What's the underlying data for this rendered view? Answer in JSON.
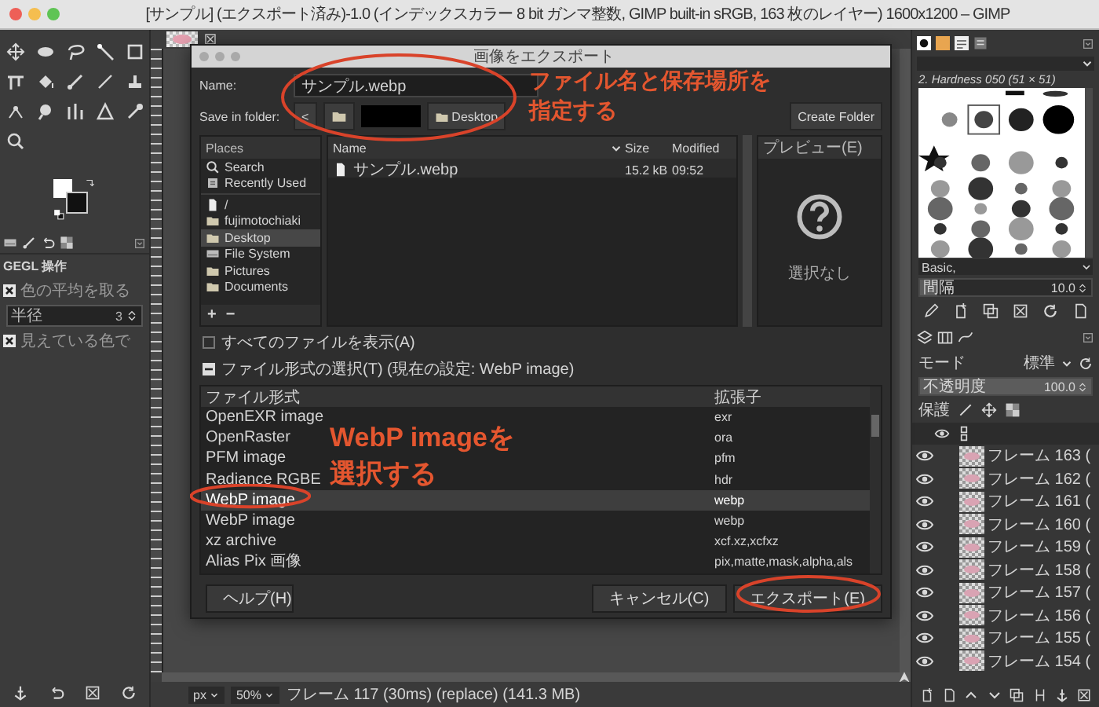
{
  "window": {
    "title": "[サンプル] (エクスポート済み)-1.0 (インデックスカラー 8 bit ガンマ整数, GIMP built-in sRGB, 163 枚のレイヤー) 1600x1200 – GIMP"
  },
  "tool_options": {
    "title": "GEGL 操作",
    "items": [
      {
        "kind": "checkbox",
        "label": "色の平均を取る",
        "checked": true
      },
      {
        "kind": "dropdown",
        "label": "半径",
        "value": "3"
      },
      {
        "kind": "checkbox",
        "label": "見えている色で",
        "checked": true
      }
    ]
  },
  "status_bar": {
    "unit": "px",
    "zoom": "50%",
    "message": "フレーム 117 (30ms) (replace) (141.3 MB)"
  },
  "right_dock": {
    "brush_name": "2. Hardness 050 (51 × 51)",
    "brush_tag": "Basic,",
    "spacing": {
      "label": "間隔",
      "value": "10.0",
      "level": 0.1
    },
    "mode": {
      "label": "モード",
      "value": "標準"
    },
    "opacity": {
      "label": "不透明度",
      "value": "100.0",
      "level": 1
    },
    "lock_label": "保護",
    "layers": [
      {
        "name": "フレーム 163 (",
        "visible": true
      },
      {
        "name": "フレーム 162 (",
        "visible": true
      },
      {
        "name": "フレーム 161 (",
        "visible": true
      },
      {
        "name": "フレーム 160 (",
        "visible": true
      },
      {
        "name": "フレーム 159 (",
        "visible": true
      },
      {
        "name": "フレーム 158 (",
        "visible": true
      },
      {
        "name": "フレーム 157 (",
        "visible": true
      },
      {
        "name": "フレーム 156 (",
        "visible": true
      },
      {
        "name": "フレーム 155 (",
        "visible": true
      },
      {
        "name": "フレーム 154 (",
        "visible": true
      }
    ]
  },
  "dialog": {
    "title": "画像をエクスポート",
    "name_label": "Name:",
    "file_name": "サンプル.webp",
    "folder_label": "Save in folder:",
    "back": "<",
    "folder_button": "Desktop",
    "create_folder": "Create Folder",
    "places": {
      "header": "Places",
      "groups": [
        [
          {
            "kind": "search",
            "label": "Search",
            "selected": false
          },
          {
            "kind": "recent",
            "label": "Recently Used",
            "selected": false
          }
        ],
        [
          {
            "kind": "file",
            "label": "/",
            "selected": false
          },
          {
            "kind": "folder",
            "label": "fujimotochiaki",
            "selected": false
          },
          {
            "kind": "folder",
            "label": "Desktop",
            "selected": true
          },
          {
            "kind": "drive",
            "label": "File System",
            "selected": false
          },
          {
            "kind": "folder",
            "label": "Pictures",
            "selected": false
          },
          {
            "kind": "folder",
            "label": "Documents",
            "selected": false
          }
        ]
      ],
      "add": "+",
      "remove": "−"
    },
    "files": {
      "columns": [
        "Name",
        "Size",
        "Modified"
      ],
      "rows": [
        {
          "name": "サンプル.webp",
          "size": "15.2 kB",
          "modified": "09:52"
        }
      ]
    },
    "preview": {
      "label": "プレビュー(E)",
      "empty_text": "選択なし"
    },
    "show_all": {
      "label": "すべてのファイルを表示(A)",
      "checked": false
    },
    "file_type": {
      "label": "ファイル形式の選択(T) (現在の設定: WebP image)",
      "expanded": true,
      "columns": [
        "ファイル形式",
        "拡張子"
      ],
      "rows": [
        {
          "format": "OpenEXR image",
          "ext": "exr",
          "selected": false
        },
        {
          "format": "OpenRaster",
          "ext": "ora",
          "selected": false
        },
        {
          "format": "PFM image",
          "ext": "pfm",
          "selected": false
        },
        {
          "format": "Radiance RGBE",
          "ext": "hdr",
          "selected": false
        },
        {
          "format": "WebP image",
          "ext": "webp",
          "selected": true
        },
        {
          "format": "WebP image",
          "ext": "webp",
          "selected": false
        },
        {
          "format": "xz archive",
          "ext": "xcf.xz,xcfxz",
          "selected": false
        },
        {
          "format": "Alias Pix 画像",
          "ext": "pix,matte,mask,alpha,als",
          "selected": false
        }
      ]
    },
    "buttons": [
      {
        "kind": "help",
        "label": "ヘルプ(H)"
      },
      {
        "kind": "cancel",
        "label": "キャンセル(C)"
      },
      {
        "kind": "export",
        "label": "エクスポート(E)"
      }
    ]
  },
  "annotations": [
    {
      "lines": [
        "ファイル名と保存場所を",
        "指定する"
      ]
    },
    {
      "lines": [
        "WebP imageを",
        "選択する"
      ]
    }
  ]
}
